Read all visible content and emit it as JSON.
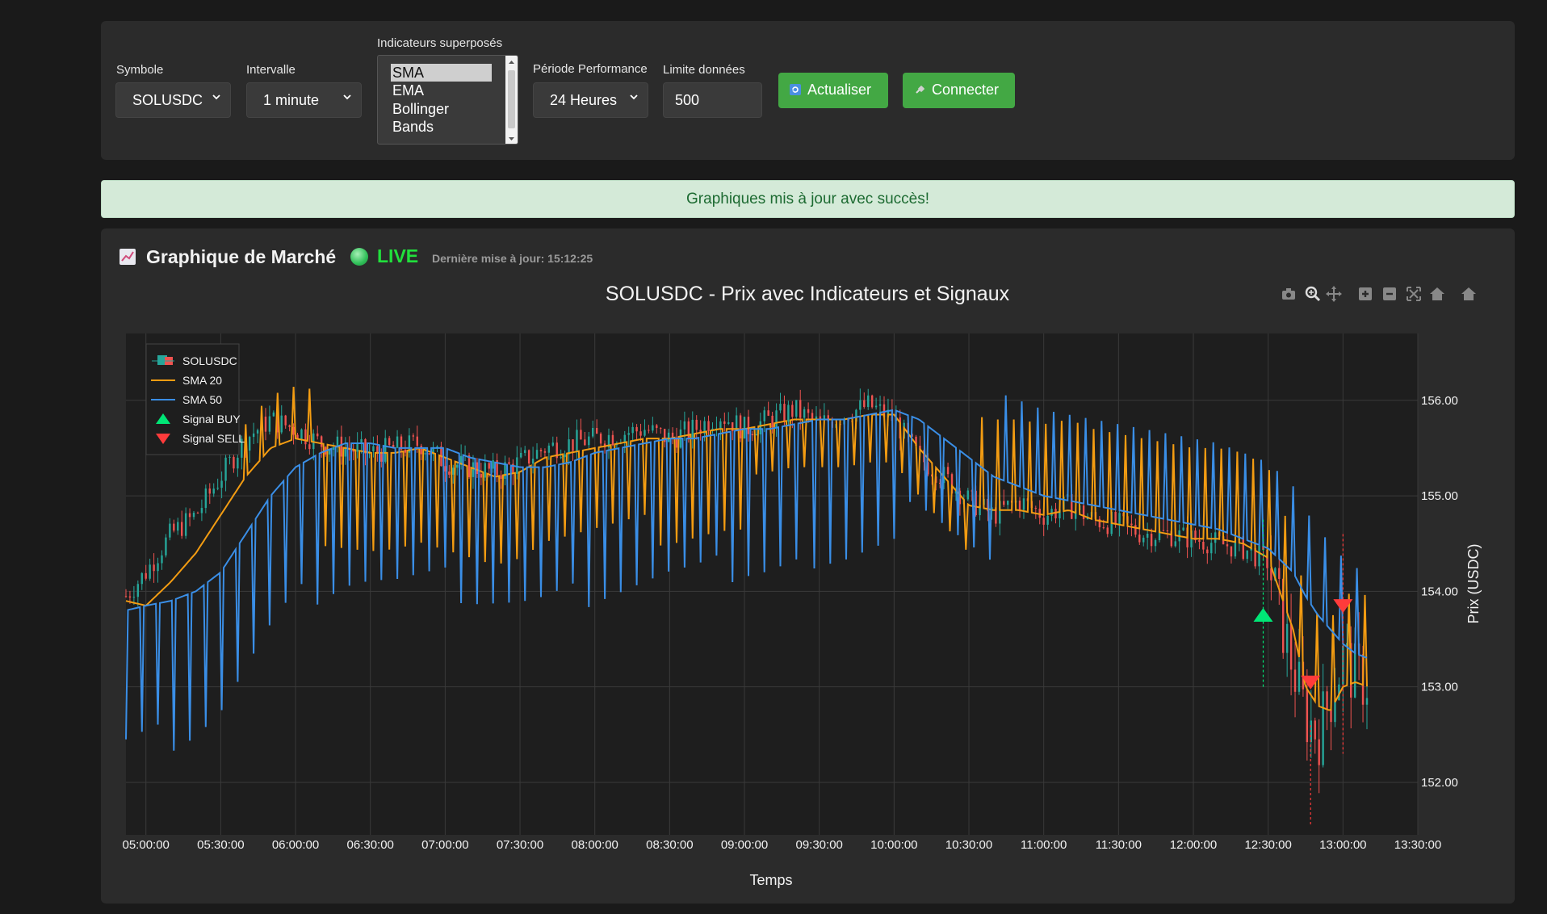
{
  "controls": {
    "symbol": {
      "label": "Symbole",
      "value": "SOLUSDC"
    },
    "interval": {
      "label": "Intervalle",
      "value": "1 minute"
    },
    "overlays": {
      "label": "Indicateurs superposés",
      "options": [
        "SMA",
        "EMA",
        "Bollinger Bands"
      ],
      "selected": "SMA"
    },
    "period": {
      "label": "Période Performance",
      "value": "24 Heures"
    },
    "limit": {
      "label": "Limite données",
      "value": "500"
    },
    "refresh_label": "Actualiser",
    "connect_label": "Connecter"
  },
  "alert_text": "Graphiques mis à jour avec succès!",
  "chart_card": {
    "title": "Graphique de Marché",
    "live_label": "LIVE",
    "last_update": "Dernière mise à jour: 15:12:25"
  },
  "colors": {
    "up": "#26a69a",
    "down": "#ef5350",
    "sma20": "#f39c12",
    "sma50": "#3a8ee6",
    "buy": "#00e676",
    "sell": "#ff3b3b",
    "button": "#43a844",
    "live": "#21e03c"
  },
  "chart_data": {
    "type": "line",
    "title": "SOLUSDC - Prix avec Indicateurs et Signaux",
    "xlabel": "Temps",
    "ylabel": "Prix (USDC)",
    "ylim": [
      151.45,
      156.7
    ],
    "y_ticks": [
      "152.00",
      "153.00",
      "154.00",
      "155.00",
      "156.00"
    ],
    "x_ticks": [
      "05:00:00",
      "05:30:00",
      "06:00:00",
      "06:30:00",
      "07:00:00",
      "07:30:00",
      "08:00:00",
      "08:30:00",
      "09:00:00",
      "09:30:00",
      "10:00:00",
      "10:30:00",
      "11:00:00",
      "11:30:00",
      "12:00:00",
      "12:30:00",
      "13:00:00",
      "13:30:00"
    ],
    "xlim": [
      "04:52",
      "13:30"
    ],
    "legend": {
      "placement": "top-left",
      "entries": [
        "SOLUSDC",
        "SMA 20",
        "SMA 50",
        "Signal BUY",
        "Signal SELL"
      ]
    },
    "grid": true,
    "series": [
      {
        "name": "SOLUSDC",
        "kind": "candlestick_close",
        "x": [
          "04:52",
          "05:00",
          "05:10",
          "05:20",
          "05:30",
          "05:40",
          "05:50",
          "06:00",
          "06:10",
          "06:20",
          "06:30",
          "06:40",
          "06:50",
          "07:00",
          "07:10",
          "07:20",
          "07:30",
          "07:40",
          "07:50",
          "08:00",
          "08:10",
          "08:20",
          "08:30",
          "08:40",
          "08:50",
          "09:00",
          "09:10",
          "09:20",
          "09:30",
          "09:40",
          "09:50",
          "10:00",
          "10:10",
          "10:20",
          "10:30",
          "10:40",
          "10:50",
          "11:00",
          "11:10",
          "11:20",
          "11:30",
          "11:40",
          "11:50",
          "12:00",
          "12:10",
          "12:20",
          "12:30",
          "12:40",
          "12:45",
          "12:50",
          "12:55",
          "13:00",
          "13:05",
          "13:10"
        ],
        "values": [
          153.95,
          154.2,
          154.6,
          154.8,
          155.2,
          155.6,
          155.8,
          155.7,
          155.55,
          155.5,
          155.45,
          155.5,
          155.55,
          155.35,
          155.3,
          155.25,
          155.35,
          155.5,
          155.55,
          155.6,
          155.65,
          155.7,
          155.6,
          155.7,
          155.85,
          155.7,
          155.8,
          155.9,
          155.75,
          155.85,
          155.95,
          155.8,
          155.4,
          155.2,
          154.95,
          154.8,
          154.95,
          154.8,
          154.9,
          154.75,
          154.7,
          154.6,
          154.6,
          154.55,
          154.5,
          154.45,
          154.3,
          153.2,
          152.7,
          152.5,
          152.9,
          153.3,
          153.1,
          153.05
        ]
      },
      {
        "name": "SMA 20",
        "x": [
          "04:52",
          "05:00",
          "05:10",
          "05:20",
          "05:30",
          "05:40",
          "05:50",
          "06:00",
          "06:10",
          "06:20",
          "06:30",
          "06:40",
          "06:50",
          "07:00",
          "07:10",
          "07:20",
          "07:30",
          "07:40",
          "07:50",
          "08:00",
          "08:10",
          "08:20",
          "08:30",
          "08:40",
          "08:50",
          "09:00",
          "09:10",
          "09:20",
          "09:30",
          "09:40",
          "09:50",
          "10:00",
          "10:10",
          "10:20",
          "10:30",
          "10:40",
          "10:50",
          "11:00",
          "11:10",
          "11:20",
          "11:30",
          "11:40",
          "11:50",
          "12:00",
          "12:10",
          "12:20",
          "12:30",
          "12:40",
          "12:45",
          "12:50",
          "12:55",
          "13:00",
          "13:05",
          "13:10"
        ],
        "values": [
          153.9,
          153.85,
          154.1,
          154.4,
          154.8,
          155.2,
          155.5,
          155.6,
          155.55,
          155.5,
          155.45,
          155.45,
          155.5,
          155.4,
          155.3,
          155.2,
          155.25,
          155.4,
          155.45,
          155.5,
          155.55,
          155.6,
          155.6,
          155.65,
          155.7,
          155.7,
          155.75,
          155.8,
          155.8,
          155.8,
          155.85,
          155.85,
          155.5,
          155.2,
          154.9,
          154.85,
          154.85,
          154.8,
          154.85,
          154.75,
          154.7,
          154.65,
          154.6,
          154.55,
          154.55,
          154.5,
          154.35,
          153.6,
          153.0,
          152.8,
          152.75,
          153.0,
          153.05,
          153.0
        ]
      },
      {
        "name": "SMA 50",
        "x": [
          "04:52",
          "05:00",
          "05:10",
          "05:20",
          "05:30",
          "05:40",
          "05:50",
          "06:00",
          "06:10",
          "06:20",
          "06:30",
          "06:40",
          "06:50",
          "07:00",
          "07:10",
          "07:20",
          "07:30",
          "07:40",
          "07:50",
          "08:00",
          "08:10",
          "08:20",
          "08:30",
          "08:40",
          "08:50",
          "09:00",
          "09:10",
          "09:20",
          "09:30",
          "09:40",
          "09:50",
          "10:00",
          "10:10",
          "10:20",
          "10:30",
          "10:40",
          "10:50",
          "11:00",
          "11:10",
          "11:20",
          "11:30",
          "11:40",
          "11:50",
          "12:00",
          "12:10",
          "12:20",
          "12:30",
          "12:40",
          "12:45",
          "12:50",
          "12:55",
          "13:00",
          "13:05",
          "13:10"
        ],
        "values": [
          153.8,
          153.85,
          153.9,
          154.0,
          154.2,
          154.6,
          155.0,
          155.3,
          155.45,
          155.55,
          155.55,
          155.5,
          155.5,
          155.5,
          155.4,
          155.35,
          155.3,
          155.3,
          155.35,
          155.45,
          155.5,
          155.55,
          155.6,
          155.6,
          155.65,
          155.7,
          155.7,
          155.75,
          155.8,
          155.8,
          155.85,
          155.9,
          155.8,
          155.6,
          155.4,
          155.2,
          155.1,
          155.0,
          154.95,
          154.9,
          154.85,
          154.8,
          154.75,
          154.7,
          154.65,
          154.55,
          154.45,
          154.2,
          153.95,
          153.75,
          153.6,
          153.45,
          153.35,
          153.3
        ]
      },
      {
        "name": "Signal BUY",
        "kind": "marker",
        "x": [
          "12:28"
        ],
        "values": [
          153.75
        ]
      },
      {
        "name": "Signal SELL",
        "kind": "marker",
        "x": [
          "12:47",
          "13:00"
        ],
        "values": [
          153.05,
          153.85
        ]
      }
    ]
  }
}
